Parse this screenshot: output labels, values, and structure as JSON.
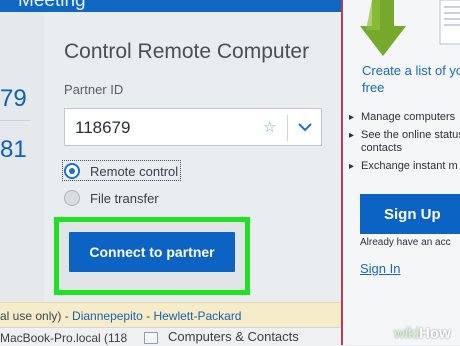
{
  "header": {
    "title": "Meeting"
  },
  "left_panel": {
    "id_fragment_1": "79",
    "id_fragment_2": "81"
  },
  "connect": {
    "title": "Control Remote Computer",
    "partner_id_label": "Partner ID",
    "partner_id_value": "118679",
    "options": [
      {
        "label": "Remote control",
        "selected": true
      },
      {
        "label": "File transfer",
        "selected": false
      }
    ],
    "connect_button": "Connect to partner"
  },
  "status_bar": {
    "license_fragment": "al use only)",
    "separator": " - ",
    "user": "Diannepepito",
    "vendor": "Hewlett-Packard"
  },
  "bottom": {
    "computer_entry": "MacBook-Pro.local (118",
    "tab_label": "Computers & Contacts"
  },
  "promo": {
    "headline": "Create a list of your computers for free",
    "bullets": [
      "Manage computers",
      "See the online status",
      "contacts",
      "Exchange instant m"
    ],
    "signup_button": "Sign Up",
    "already_text": "Already have an acc",
    "signin_link": "Sign In"
  },
  "watermark": {
    "wiki": "wiki",
    "how": "How"
  },
  "colors": {
    "accent": "#0d63c4",
    "highlight": "#22e022",
    "status_bg": "#f5ecc9",
    "divider": "#b43d55",
    "arrow": "#76a82b"
  },
  "icons": [
    "star-icon",
    "chevron-down-icon",
    "radio-selected-icon",
    "radio-empty-icon",
    "arrow-down-icon",
    "laptop-icon"
  ]
}
